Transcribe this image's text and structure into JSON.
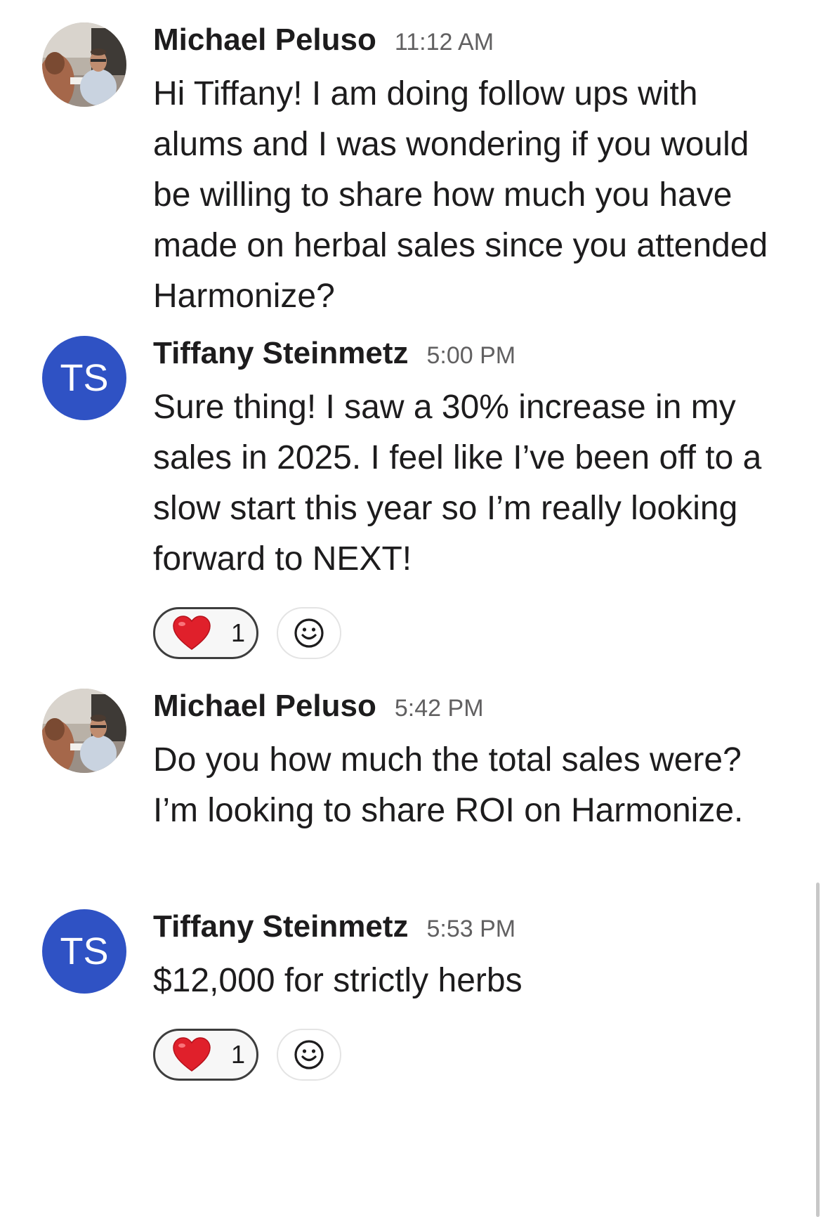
{
  "colors": {
    "avatar_bg": "#2f52c4",
    "text": "#1d1c1d",
    "timestamp": "#616061",
    "heart": "#e0202b"
  },
  "messages": [
    {
      "author": "Michael Peluso",
      "time": "11:12 AM",
      "avatar": "photo",
      "text": "Hi Tiffany! I am doing follow ups with alums and I was wondering if you would be willing to share how much you have made on herbal sales since you attended Harmonize?"
    },
    {
      "author": "Tiffany Steinmetz",
      "time": "5:00 PM",
      "avatar": "initials",
      "initials": "TS",
      "text": "Sure thing! I saw a 30% increase in my sales in 2025. I feel like I’ve been off to a slow start this year so I’m really looking forward to NEXT!",
      "reaction": {
        "icon": "heart-icon",
        "count": "1"
      },
      "add_reaction_icon": "smiley-icon"
    },
    {
      "author": "Michael Peluso",
      "time": "5:42 PM",
      "avatar": "photo",
      "text": "Do you how much the total sales were? I’m looking to share ROI on Harmonize."
    },
    {
      "author": "Tiffany Steinmetz",
      "time": "5:53 PM",
      "avatar": "initials",
      "initials": "TS",
      "text": "$12,000 for strictly herbs",
      "reaction": {
        "icon": "heart-icon",
        "count": "1"
      },
      "add_reaction_icon": "smiley-icon"
    }
  ]
}
